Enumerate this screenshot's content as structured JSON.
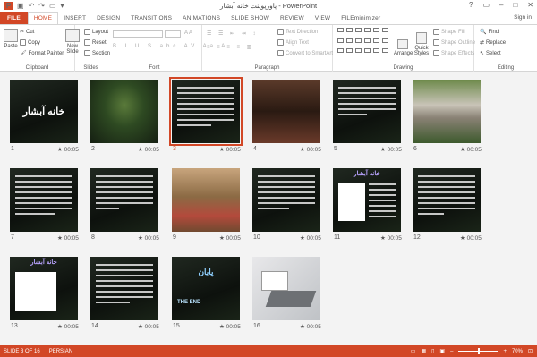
{
  "window": {
    "title": "پاورپوینت خانه آبشار - PowerPoint",
    "help": "?",
    "minimize": "–",
    "restore": "□",
    "close": "✕",
    "sign_in": "Sign in"
  },
  "tabs": [
    "FILE",
    "HOME",
    "INSERT",
    "DESIGN",
    "TRANSITIONS",
    "ANIMATIONS",
    "SLIDE SHOW",
    "REVIEW",
    "VIEW",
    "FILEminimizer"
  ],
  "ribbon": {
    "clipboard": {
      "label": "Clipboard",
      "paste": "Paste",
      "cut": "Cut",
      "copy": "Copy",
      "format_painter": "Format Painter"
    },
    "slides": {
      "label": "Slides",
      "new_slide": "New Slide",
      "layout": "Layout",
      "reset": "Reset",
      "section": "Section"
    },
    "font": {
      "label": "Font"
    },
    "paragraph": {
      "label": "Paragraph",
      "text_direction": "Text Direction",
      "align_text": "Align Text",
      "convert": "Convert to SmartArt"
    },
    "drawing": {
      "label": "Drawing",
      "arrange": "Arrange",
      "quick_styles": "Quick Styles",
      "shape_fill": "Shape Fill",
      "shape_outline": "Shape Outline",
      "shape_effects": "Shape Effects"
    },
    "editing": {
      "label": "Editing",
      "find": "Find",
      "replace": "Replace",
      "select": "Select"
    }
  },
  "slides": [
    {
      "num": "1",
      "time": "00:05",
      "caption": "خانه آبشار"
    },
    {
      "num": "2",
      "time": "00:05"
    },
    {
      "num": "3",
      "time": "00:05",
      "selected": true
    },
    {
      "num": "4",
      "time": "00:05"
    },
    {
      "num": "5",
      "time": "00:05"
    },
    {
      "num": "6",
      "time": "00:05"
    },
    {
      "num": "7",
      "time": "00:05"
    },
    {
      "num": "8",
      "time": "00:05"
    },
    {
      "num": "9",
      "time": "00:05"
    },
    {
      "num": "10",
      "time": "00:05"
    },
    {
      "num": "11",
      "time": "00:05",
      "caption": "خانه آبشار"
    },
    {
      "num": "12",
      "time": "00:05"
    },
    {
      "num": "13",
      "time": "00:05",
      "caption": "خانه آبشار"
    },
    {
      "num": "14",
      "time": "00:05"
    },
    {
      "num": "15",
      "time": "00:05",
      "caption": "پایان",
      "caption2": "THE END"
    },
    {
      "num": "16",
      "time": "00:05"
    }
  ],
  "status": {
    "slide": "SLIDE 3 OF 16",
    "lang": "PERSIAN",
    "zoom": "70%"
  },
  "colors": {
    "accent": "#d24726"
  }
}
